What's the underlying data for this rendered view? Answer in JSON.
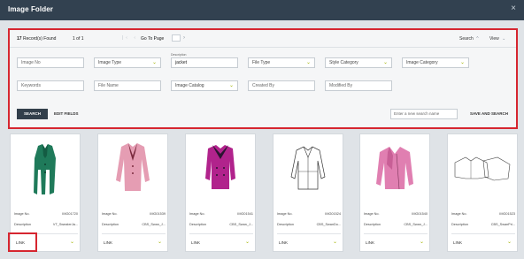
{
  "window": {
    "title": "Image Folder",
    "close_glyph": "×"
  },
  "toolbar": {
    "record_count": "17",
    "record_label": "Record(s) Found",
    "page_info": "1 of 1",
    "pager_glyphs": "|‹ ‹ › ›|",
    "goto_label": "Go To Page",
    "goto_next": "›",
    "search_label": "Search",
    "search_caret": "^",
    "view_label": "View",
    "view_caret": "⌄"
  },
  "filters": {
    "image_no": {
      "placeholder": "Image No",
      "value": ""
    },
    "image_type": {
      "value": "Image Type"
    },
    "description": {
      "caption": "Description",
      "value": "jacket"
    },
    "file_type": {
      "value": "File Type"
    },
    "style_category": {
      "value": "Style Category"
    },
    "image_category": {
      "value": "Image Category"
    },
    "keywords": {
      "placeholder": "Keywords",
      "value": ""
    },
    "file_name": {
      "placeholder": "File Name",
      "value": ""
    },
    "image_catalog": {
      "value": "Image Catalog"
    },
    "created_by": {
      "placeholder": "Created By",
      "value": ""
    },
    "modified_by": {
      "placeholder": "Modified By",
      "value": ""
    },
    "chevron_glyph": "⌄"
  },
  "actions": {
    "search_button": "SEARCH",
    "edit_fields": "EDIT FIELDS",
    "new_search_placeholder": "Enter a new search name",
    "save_and_search": "SAVE AND SEARCH"
  },
  "cards": [
    {
      "image_no_label": "Image No.",
      "image_no": "IMG01720",
      "desc_label": "Description",
      "description": "VT_SweaterJa...",
      "link_label": "LINK",
      "color": "#1f7a5a"
    },
    {
      "image_no_label": "Image No.",
      "image_no": "IMG01539",
      "desc_label": "Description",
      "description": "CBS_Swan_J...",
      "link_label": "LINK",
      "color": "#e59db3"
    },
    {
      "image_no_label": "Image No.",
      "image_no": "IMG01541",
      "desc_label": "Description",
      "description": "CBS_Swan_J...",
      "link_label": "LINK",
      "color": "#b1238c"
    },
    {
      "image_no_label": "Image No.",
      "image_no": "IMG01524",
      "desc_label": "Description",
      "description": "CBS_SwanDo...",
      "link_label": "LINK",
      "color": "#ffffff"
    },
    {
      "image_no_label": "Image No.",
      "image_no": "IMG01540",
      "desc_label": "Description",
      "description": "CBS_Swan_J...",
      "link_label": "LINK",
      "color": "#e07fb1"
    },
    {
      "image_no_label": "Image No.",
      "image_no": "IMG01523",
      "desc_label": "Description",
      "description": "CBS_SwanPri...",
      "link_label": "LINK",
      "color": "#ffffff"
    }
  ]
}
